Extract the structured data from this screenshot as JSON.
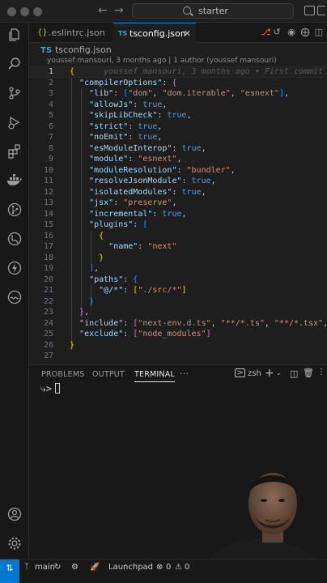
{
  "titlebar": {
    "search_label": "starter",
    "back_icon": "arrow-left-icon",
    "forward_icon": "arrow-right-icon"
  },
  "activity_bar": {
    "items": [
      "files-icon",
      "search-icon",
      "source-control-icon",
      "run-debug-icon",
      "extensions-icon",
      "docker-icon",
      "git-graph-icon",
      "remote-explorer-icon",
      "lightning-icon",
      "live-share-icon"
    ],
    "bottom": [
      "account-icon",
      "settings-gear-icon"
    ]
  },
  "tabs": [
    {
      "label": ".eslintrc.json",
      "icon": "{}",
      "active": false
    },
    {
      "label": "tsconfig.json",
      "icon": "TS",
      "active": true
    }
  ],
  "breadcrumb": {
    "file": "tsconfig.json",
    "icon": "TS"
  },
  "blame": {
    "header": "youssef mansouri, 3 months ago | 1 author (youssef mansouri)",
    "inline": "youssef mansouri, 3 months ago • First commit"
  },
  "editor": {
    "current_line": 1,
    "lines": [
      {
        "n": "1",
        "segs": [
          [
            "br1",
            "{"
          ]
        ]
      },
      {
        "n": "2",
        "segs": [
          [
            "p",
            "  "
          ],
          [
            "k",
            "\"compilerOptions\""
          ],
          [
            "p",
            ": "
          ],
          [
            "br2",
            "{"
          ]
        ]
      },
      {
        "n": "3",
        "segs": [
          [
            "p",
            "    "
          ],
          [
            "k",
            "\"lib\""
          ],
          [
            "p",
            ": "
          ],
          [
            "br3",
            "["
          ],
          [
            "s",
            "\"dom\""
          ],
          [
            "p",
            ", "
          ],
          [
            "s",
            "\"dom.iterable\""
          ],
          [
            "p",
            ", "
          ],
          [
            "s",
            "\"esnext\""
          ],
          [
            "br3",
            "]"
          ],
          [
            "p",
            ","
          ]
        ]
      },
      {
        "n": "4",
        "segs": [
          [
            "p",
            "    "
          ],
          [
            "k",
            "\"allowJs\""
          ],
          [
            "p",
            ": "
          ],
          [
            "b",
            "true"
          ],
          [
            "p",
            ","
          ]
        ]
      },
      {
        "n": "5",
        "segs": [
          [
            "p",
            "    "
          ],
          [
            "k",
            "\"skipLibCheck\""
          ],
          [
            "p",
            ": "
          ],
          [
            "b",
            "true"
          ],
          [
            "p",
            ","
          ]
        ]
      },
      {
        "n": "6",
        "segs": [
          [
            "p",
            "    "
          ],
          [
            "k",
            "\"strict\""
          ],
          [
            "p",
            ": "
          ],
          [
            "b",
            "true"
          ],
          [
            "p",
            ","
          ]
        ]
      },
      {
        "n": "7",
        "segs": [
          [
            "p",
            "    "
          ],
          [
            "k",
            "\"noEmit\""
          ],
          [
            "p",
            ": "
          ],
          [
            "b",
            "true"
          ],
          [
            "p",
            ","
          ]
        ]
      },
      {
        "n": "8",
        "segs": [
          [
            "p",
            "    "
          ],
          [
            "k",
            "\"esModuleInterop\""
          ],
          [
            "p",
            ": "
          ],
          [
            "b",
            "true"
          ],
          [
            "p",
            ","
          ]
        ]
      },
      {
        "n": "9",
        "segs": [
          [
            "p",
            "    "
          ],
          [
            "k",
            "\"module\""
          ],
          [
            "p",
            ": "
          ],
          [
            "s",
            "\"esnext\""
          ],
          [
            "p",
            ","
          ]
        ]
      },
      {
        "n": "10",
        "segs": [
          [
            "p",
            "    "
          ],
          [
            "k",
            "\"moduleResolution\""
          ],
          [
            "p",
            ": "
          ],
          [
            "s",
            "\"bundler\""
          ],
          [
            "p",
            ","
          ]
        ]
      },
      {
        "n": "11",
        "segs": [
          [
            "p",
            "    "
          ],
          [
            "k",
            "\"resolveJsonModule\""
          ],
          [
            "p",
            ": "
          ],
          [
            "b",
            "true"
          ],
          [
            "p",
            ","
          ]
        ]
      },
      {
        "n": "12",
        "segs": [
          [
            "p",
            "    "
          ],
          [
            "k",
            "\"isolatedModules\""
          ],
          [
            "p",
            ": "
          ],
          [
            "b",
            "true"
          ],
          [
            "p",
            ","
          ]
        ]
      },
      {
        "n": "13",
        "segs": [
          [
            "p",
            "    "
          ],
          [
            "k",
            "\"jsx\""
          ],
          [
            "p",
            ": "
          ],
          [
            "s",
            "\"preserve\""
          ],
          [
            "p",
            ","
          ]
        ]
      },
      {
        "n": "14",
        "segs": [
          [
            "p",
            "    "
          ],
          [
            "k",
            "\"incremental\""
          ],
          [
            "p",
            ": "
          ],
          [
            "b",
            "true"
          ],
          [
            "p",
            ","
          ]
        ]
      },
      {
        "n": "15",
        "segs": [
          [
            "p",
            "    "
          ],
          [
            "k",
            "\"plugins\""
          ],
          [
            "p",
            ": "
          ],
          [
            "br3",
            "["
          ]
        ]
      },
      {
        "n": "16",
        "segs": [
          [
            "p",
            "      "
          ],
          [
            "br1",
            "{"
          ]
        ]
      },
      {
        "n": "17",
        "segs": [
          [
            "p",
            "        "
          ],
          [
            "k",
            "\"name\""
          ],
          [
            "p",
            ": "
          ],
          [
            "s",
            "\"next\""
          ]
        ]
      },
      {
        "n": "18",
        "segs": [
          [
            "p",
            "      "
          ],
          [
            "br1",
            "}"
          ]
        ]
      },
      {
        "n": "19",
        "segs": [
          [
            "p",
            "    "
          ],
          [
            "br3",
            "]"
          ],
          [
            "p",
            ","
          ]
        ]
      },
      {
        "n": "20",
        "segs": [
          [
            "p",
            "    "
          ],
          [
            "k",
            "\"paths\""
          ],
          [
            "p",
            ": "
          ],
          [
            "br3",
            "{"
          ]
        ]
      },
      {
        "n": "21",
        "segs": [
          [
            "p",
            "      "
          ],
          [
            "k",
            "\"@/*\""
          ],
          [
            "p",
            ": "
          ],
          [
            "br1",
            "["
          ],
          [
            "s",
            "\"./src/*\""
          ],
          [
            "br1",
            "]"
          ]
        ]
      },
      {
        "n": "22",
        "segs": [
          [
            "p",
            "    "
          ],
          [
            "br3",
            "}"
          ]
        ]
      },
      {
        "n": "23",
        "segs": [
          [
            "p",
            "  "
          ],
          [
            "br2",
            "}"
          ],
          [
            "p",
            ","
          ]
        ]
      },
      {
        "n": "24",
        "segs": [
          [
            "p",
            "  "
          ],
          [
            "k",
            "\"include\""
          ],
          [
            "p",
            ": "
          ],
          [
            "br2",
            "["
          ],
          [
            "s",
            "\"next-env.d.ts\""
          ],
          [
            "p",
            ", "
          ],
          [
            "s",
            "\"**/*.ts\""
          ],
          [
            "p",
            ", "
          ],
          [
            "s",
            "\"**/*.tsx\""
          ],
          [
            "p",
            ", "
          ],
          [
            "s",
            "\".ne"
          ]
        ]
      },
      {
        "n": "25",
        "segs": [
          [
            "p",
            "  "
          ],
          [
            "k",
            "\"exclude\""
          ],
          [
            "p",
            ": "
          ],
          [
            "br2",
            "["
          ],
          [
            "s",
            "\"node_modules\""
          ],
          [
            "br2",
            "]"
          ]
        ]
      },
      {
        "n": "26",
        "segs": [
          [
            "br1",
            "}"
          ]
        ]
      },
      {
        "n": "27",
        "segs": []
      }
    ]
  },
  "panel": {
    "tabs": [
      "PROBLEMS",
      "OUTPUT",
      "TERMINAL"
    ],
    "active_tab": "TERMINAL",
    "more": "···",
    "shell": "zsh",
    "prompt": "⤷>"
  },
  "statusbar": {
    "branch": "main",
    "launchpad": "Launchpad",
    "errors": "0",
    "warnings": "0"
  }
}
